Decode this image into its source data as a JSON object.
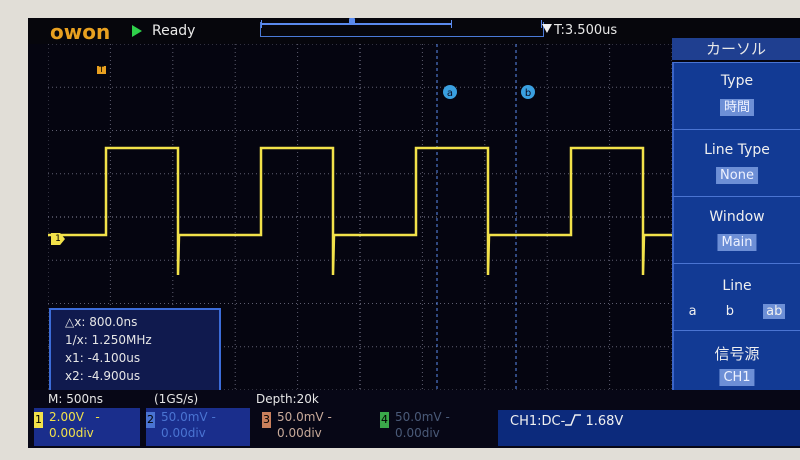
{
  "brand": "owon",
  "colors": {
    "ch1": "#f2e24a",
    "ch2": "#4a74d2",
    "ch3": "#c97f5c",
    "ch4": "#3aa84a",
    "menu_bg": "#123a94",
    "accent": "#e8a020"
  },
  "header": {
    "run_icon": "play-triangle-icon",
    "status": "Ready",
    "trigger_position": "T:3.500us"
  },
  "menu": {
    "title": "カーソル",
    "items": [
      {
        "label": "Type",
        "value": "時間"
      },
      {
        "label": "Line Type",
        "value": "None"
      },
      {
        "label": "Window",
        "value": "Main"
      },
      {
        "label": "Line",
        "options": [
          "a",
          "b",
          "ab"
        ],
        "selected": "ab"
      },
      {
        "label": "信号源",
        "value": "CH1"
      }
    ]
  },
  "cursors": {
    "a_label": "a",
    "b_label": "b",
    "delta_x": "△x: 800.0ns",
    "inv_delta_x": "1/x: 1.250MHz",
    "x1": "x1: -4.100us",
    "x2": "x2: -4.900us"
  },
  "ch1_marker": "1",
  "timebase": {
    "main": "M: 500ns",
    "sample_rate": "(1GS/s)",
    "depth": "Depth:20k"
  },
  "channels": [
    {
      "num": "1",
      "volts": "2.00V",
      "coupling": "-",
      "offset": "0.00div",
      "color": "#f2e24a"
    },
    {
      "num": "2",
      "volts": "50.0mV",
      "coupling": "-",
      "offset": "0.00div",
      "color": "#4a74d2"
    },
    {
      "num": "3",
      "volts": "50.0mV",
      "coupling": "-",
      "offset": "0.00div",
      "color": "#c97f5c"
    },
    {
      "num": "4",
      "volts": "50.0mV",
      "coupling": "-",
      "offset": "0.00div",
      "color": "#3aa84a"
    }
  ],
  "trigger": {
    "source_label": "CH1:DC-",
    "slope_icon": "rising-edge-icon",
    "level": "1.68V"
  }
}
